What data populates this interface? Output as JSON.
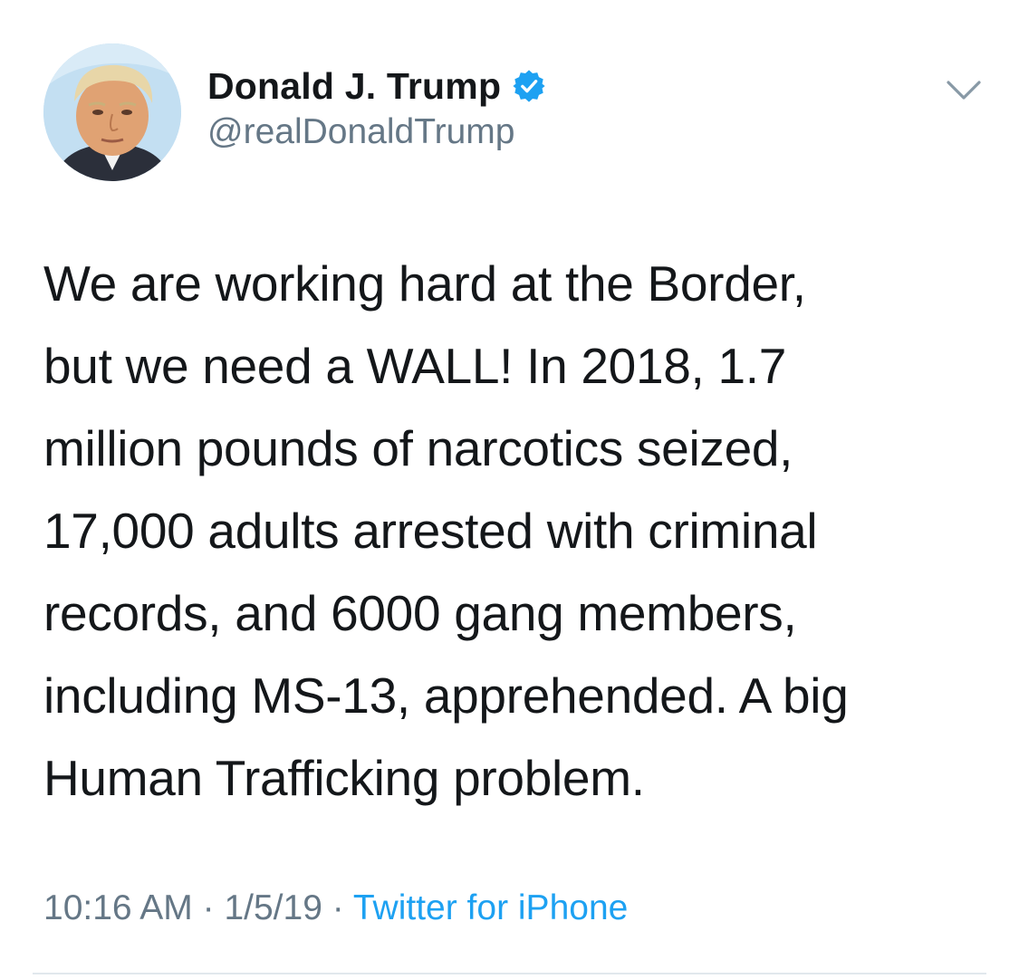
{
  "author": {
    "display_name": "Donald J. Trump",
    "handle": "@realDonaldTrump",
    "verified": true
  },
  "tweet": {
    "text": "We are working hard at the Border,\nbut we need a WALL!  In 2018, 1.7\nmillion pounds of narcotics seized,\n17,000 adults arrested with criminal\nrecords, and 6000 gang members,\nincluding MS-13, apprehended. A big\nHuman Trafficking problem."
  },
  "meta": {
    "time": "10:16 AM",
    "separator": " · ",
    "date": "1/5/19",
    "source": "Twitter for iPhone"
  },
  "icons": {
    "verified": "verified-badge-icon",
    "menu": "chevron-down-icon"
  },
  "colors": {
    "text": "#14171a",
    "secondary": "#657786",
    "link": "#1da1f2",
    "verified": "#1da1f2",
    "divider": "#e1e8ed"
  }
}
